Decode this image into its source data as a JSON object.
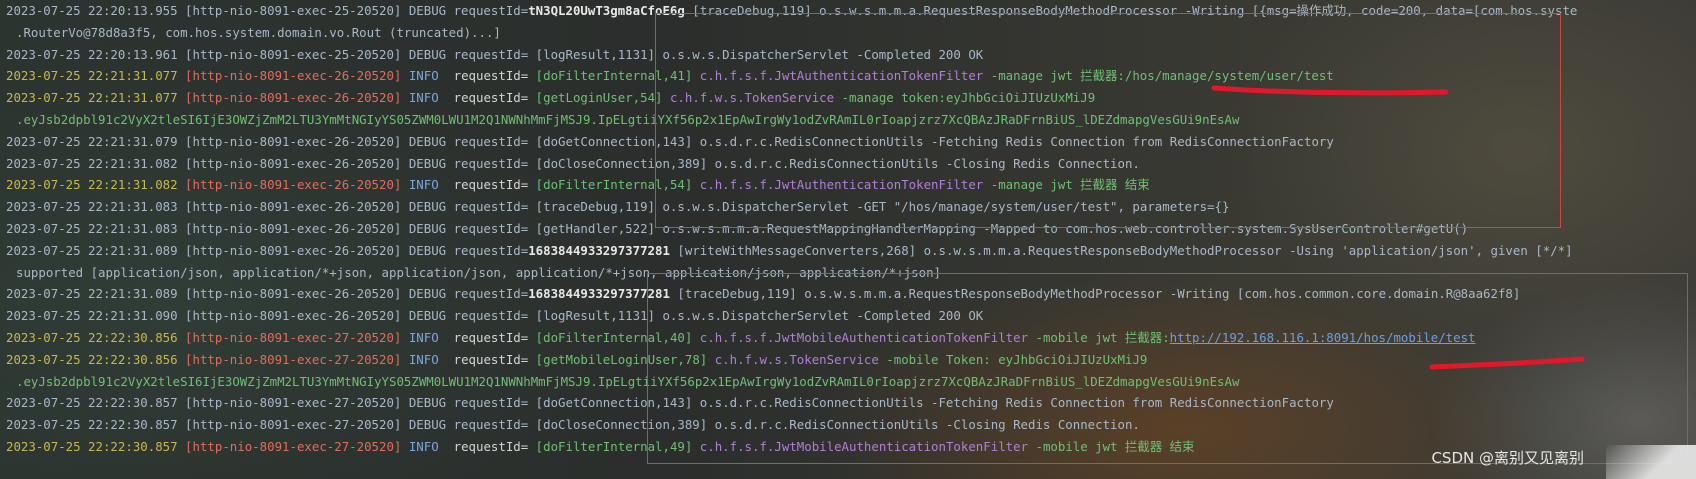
{
  "console": {
    "lines": [
      {
        "style": "dim",
        "cont": false,
        "parts": [
          {
            "c": "plain",
            "t": "2023-07-25 22:20:13.955 [http-nio-8091-exec-25-20520] DEBUG requestId="
          },
          {
            "c": "bold",
            "t": "tN3QL20UwT3gm8aCfoE6g"
          },
          {
            "c": "plain",
            "t": " [traceDebug,119] o.s.w.s.m.m.a.RequestResponseBodyMethodProcessor -Writing [{msg=操作成功, code=200, data=[com.hos.syste"
          }
        ]
      },
      {
        "style": "dim",
        "cont": true,
        "parts": [
          {
            "c": "plain",
            "t": ".RouterVo@78d8a3f5, com.hos.system.domain.vo.Rout (truncated)...]"
          }
        ]
      },
      {
        "style": "dim",
        "cont": false,
        "parts": [
          {
            "c": "plain",
            "t": "2023-07-25 22:20:13.961 [http-nio-8091-exec-25-20520] DEBUG requestId= [logResult,1131] o.s.w.s.DispatcherServlet -Completed 200 OK"
          }
        ]
      },
      {
        "style": "info",
        "cont": false,
        "parts": [
          {
            "c": "ts",
            "t": "2023-07-25 22:21:31.077 "
          },
          {
            "c": "th",
            "t": "[http-nio-8091-exec-26-20520] "
          },
          {
            "c": "info",
            "t": "INFO  "
          },
          {
            "c": "pfx",
            "t": "requestId= "
          },
          {
            "c": "meth",
            "t": "[doFilterInternal,41] "
          },
          {
            "c": "cls",
            "t": "c.h.f.s.f.JwtAuthenticationTokenFilter "
          },
          {
            "c": "meth",
            "t": "-manage jwt 拦截器:/hos/manage/system/user/test"
          }
        ]
      },
      {
        "style": "info",
        "cont": false,
        "parts": [
          {
            "c": "ts",
            "t": "2023-07-25 22:21:31.077 "
          },
          {
            "c": "th",
            "t": "[http-nio-8091-exec-26-20520] "
          },
          {
            "c": "info",
            "t": "INFO  "
          },
          {
            "c": "pfx",
            "t": "requestId= "
          },
          {
            "c": "meth",
            "t": "[getLoginUser,54] "
          },
          {
            "c": "cls",
            "t": "c.h.f.w.s.TokenService "
          },
          {
            "c": "meth",
            "t": "-manage token:eyJhbGciOiJIUzUxMiJ9"
          }
        ]
      },
      {
        "style": "info",
        "cont": true,
        "parts": [
          {
            "c": "meth",
            "t": ".eyJsb2dpbl91c2VyX2tleSI6IjE3OWZjZmM2LTU3YmMtNGIyYS05ZWM0LWU1M2Q1NWNhMmFjMSJ9.IpELgtiiYXf56p2x1EpAwIrgWy1odZvRAmIL0rIoapjzrz7XcQBAzJRaDFrnBiUS_lDEZdmapgVesGUi9nEsAw"
          }
        ]
      },
      {
        "style": "dim",
        "cont": false,
        "parts": [
          {
            "c": "plain",
            "t": "2023-07-25 22:21:31.079 [http-nio-8091-exec-26-20520] DEBUG requestId= [doGetConnection,143] o.s.d.r.c.RedisConnectionUtils -Fetching Redis Connection from RedisConnectionFactory"
          }
        ]
      },
      {
        "style": "dim",
        "cont": false,
        "parts": [
          {
            "c": "plain",
            "t": "2023-07-25 22:21:31.082 [http-nio-8091-exec-26-20520] DEBUG requestId= [doCloseConnection,389] o.s.d.r.c.RedisConnectionUtils -Closing Redis Connection."
          }
        ]
      },
      {
        "style": "info",
        "cont": false,
        "parts": [
          {
            "c": "ts",
            "t": "2023-07-25 22:21:31.082 "
          },
          {
            "c": "th",
            "t": "[http-nio-8091-exec-26-20520] "
          },
          {
            "c": "info",
            "t": "INFO  "
          },
          {
            "c": "pfx",
            "t": "requestId= "
          },
          {
            "c": "meth",
            "t": "[doFilterInternal,54] "
          },
          {
            "c": "cls",
            "t": "c.h.f.s.f.JwtAuthenticationTokenFilter "
          },
          {
            "c": "meth",
            "t": "-manage jwt 拦截器 结束"
          }
        ]
      },
      {
        "style": "dim",
        "cont": false,
        "parts": [
          {
            "c": "plain",
            "t": "2023-07-25 22:21:31.083 [http-nio-8091-exec-26-20520] DEBUG requestId= [traceDebug,119] o.s.w.s.DispatcherServlet -GET \"/hos/manage/system/user/test\", parameters={}"
          }
        ]
      },
      {
        "style": "dim",
        "cont": false,
        "parts": [
          {
            "c": "plain",
            "t": "2023-07-25 22:21:31.083 [http-nio-8091-exec-26-20520] DEBUG requestId= [getHandler,522] o.s.w.s.m.m.a.RequestMappingHandlerMapping -Mapped to com.hos.web.controller.system.SysUserController#getU()"
          }
        ]
      },
      {
        "style": "dim",
        "cont": false,
        "parts": [
          {
            "c": "plain",
            "t": "2023-07-25 22:21:31.089 [http-nio-8091-exec-26-20520] DEBUG requestId="
          },
          {
            "c": "bold",
            "t": "1683844933297377281"
          },
          {
            "c": "plain",
            "t": " [writeWithMessageConverters,268] o.s.w.s.m.m.a.RequestResponseBodyMethodProcessor -Using 'application/json', given [*/*]"
          }
        ]
      },
      {
        "style": "dim",
        "cont": true,
        "parts": [
          {
            "c": "plain",
            "t": "supported [application/json, application/*+json, application/json, application/*+json, application/json, application/*+json]"
          }
        ]
      },
      {
        "style": "dim",
        "cont": false,
        "parts": [
          {
            "c": "plain",
            "t": "2023-07-25 22:21:31.089 [http-nio-8091-exec-26-20520] DEBUG requestId="
          },
          {
            "c": "bold",
            "t": "1683844933297377281"
          },
          {
            "c": "plain",
            "t": " [traceDebug,119] o.s.w.s.m.m.a.RequestResponseBodyMethodProcessor -Writing [com.hos.common.core.domain.R@8aa62f8]"
          }
        ]
      },
      {
        "style": "dim",
        "cont": false,
        "parts": [
          {
            "c": "plain",
            "t": "2023-07-25 22:21:31.090 [http-nio-8091-exec-26-20520] DEBUG requestId= [logResult,1131] o.s.w.s.DispatcherServlet -Completed 200 OK"
          }
        ]
      },
      {
        "style": "info",
        "cont": false,
        "parts": [
          {
            "c": "ts",
            "t": "2023-07-25 22:22:30.856 "
          },
          {
            "c": "th",
            "t": "[http-nio-8091-exec-27-20520] "
          },
          {
            "c": "info",
            "t": "INFO  "
          },
          {
            "c": "pfx",
            "t": "requestId= "
          },
          {
            "c": "meth",
            "t": "[doFilterInternal,40] "
          },
          {
            "c": "cls",
            "t": "c.h.f.s.f.JwtMobileAuthenticationTokenFilter "
          },
          {
            "c": "meth",
            "t": "-mobile jwt 拦截器:"
          },
          {
            "c": "link",
            "t": "http://192.168.116.1:8091/hos/mobile/test"
          }
        ]
      },
      {
        "style": "info",
        "cont": false,
        "parts": [
          {
            "c": "ts",
            "t": "2023-07-25 22:22:30.856 "
          },
          {
            "c": "th",
            "t": "[http-nio-8091-exec-27-20520] "
          },
          {
            "c": "info",
            "t": "INFO  "
          },
          {
            "c": "pfx",
            "t": "requestId= "
          },
          {
            "c": "meth",
            "t": "[getMobileLoginUser,78] "
          },
          {
            "c": "cls",
            "t": "c.h.f.w.s.TokenService "
          },
          {
            "c": "meth",
            "t": "-mobile Token: eyJhbGciOiJIUzUxMiJ9"
          }
        ]
      },
      {
        "style": "info",
        "cont": true,
        "parts": [
          {
            "c": "meth",
            "t": ".eyJsb2dpbl91c2VyX2tleSI6IjE3OWZjZmM2LTU3YmMtNGIyYS05ZWM0LWU1M2Q1NWNhMmFjMSJ9.IpELgtiiYXf56p2x1EpAwIrgWy1odZvRAmIL0rIoapjzrz7XcQBAzJRaDFrnBiUS_lDEZdmapgVesGUi9nEsAw"
          }
        ]
      },
      {
        "style": "dim",
        "cont": false,
        "parts": [
          {
            "c": "plain",
            "t": "2023-07-25 22:22:30.857 [http-nio-8091-exec-27-20520] DEBUG requestId= [doGetConnection,143] o.s.d.r.c.RedisConnectionUtils -Fetching Redis Connection from RedisConnectionFactory"
          }
        ]
      },
      {
        "style": "dim",
        "cont": false,
        "parts": [
          {
            "c": "plain",
            "t": "2023-07-25 22:22:30.857 [http-nio-8091-exec-27-20520] DEBUG requestId= [doCloseConnection,389] o.s.d.r.c.RedisConnectionUtils -Closing Redis Connection."
          }
        ]
      },
      {
        "style": "info",
        "cont": false,
        "parts": [
          {
            "c": "ts",
            "t": "2023-07-25 22:22:30.857 "
          },
          {
            "c": "th",
            "t": "[http-nio-8091-exec-27-20520] "
          },
          {
            "c": "info",
            "t": "INFO  "
          },
          {
            "c": "pfx",
            "t": "requestId= "
          },
          {
            "c": "meth",
            "t": "[doFilterInternal,49] "
          },
          {
            "c": "cls",
            "t": "c.h.f.s.f.JwtMobileAuthenticationTokenFilter "
          },
          {
            "c": "meth",
            "t": "-mobile jwt 拦截器 结束"
          }
        ]
      }
    ]
  },
  "watermark": "CSDN @离别又见离别",
  "colors": {
    "annotation_red": "#d94040",
    "underline_red": "#e0182a"
  }
}
